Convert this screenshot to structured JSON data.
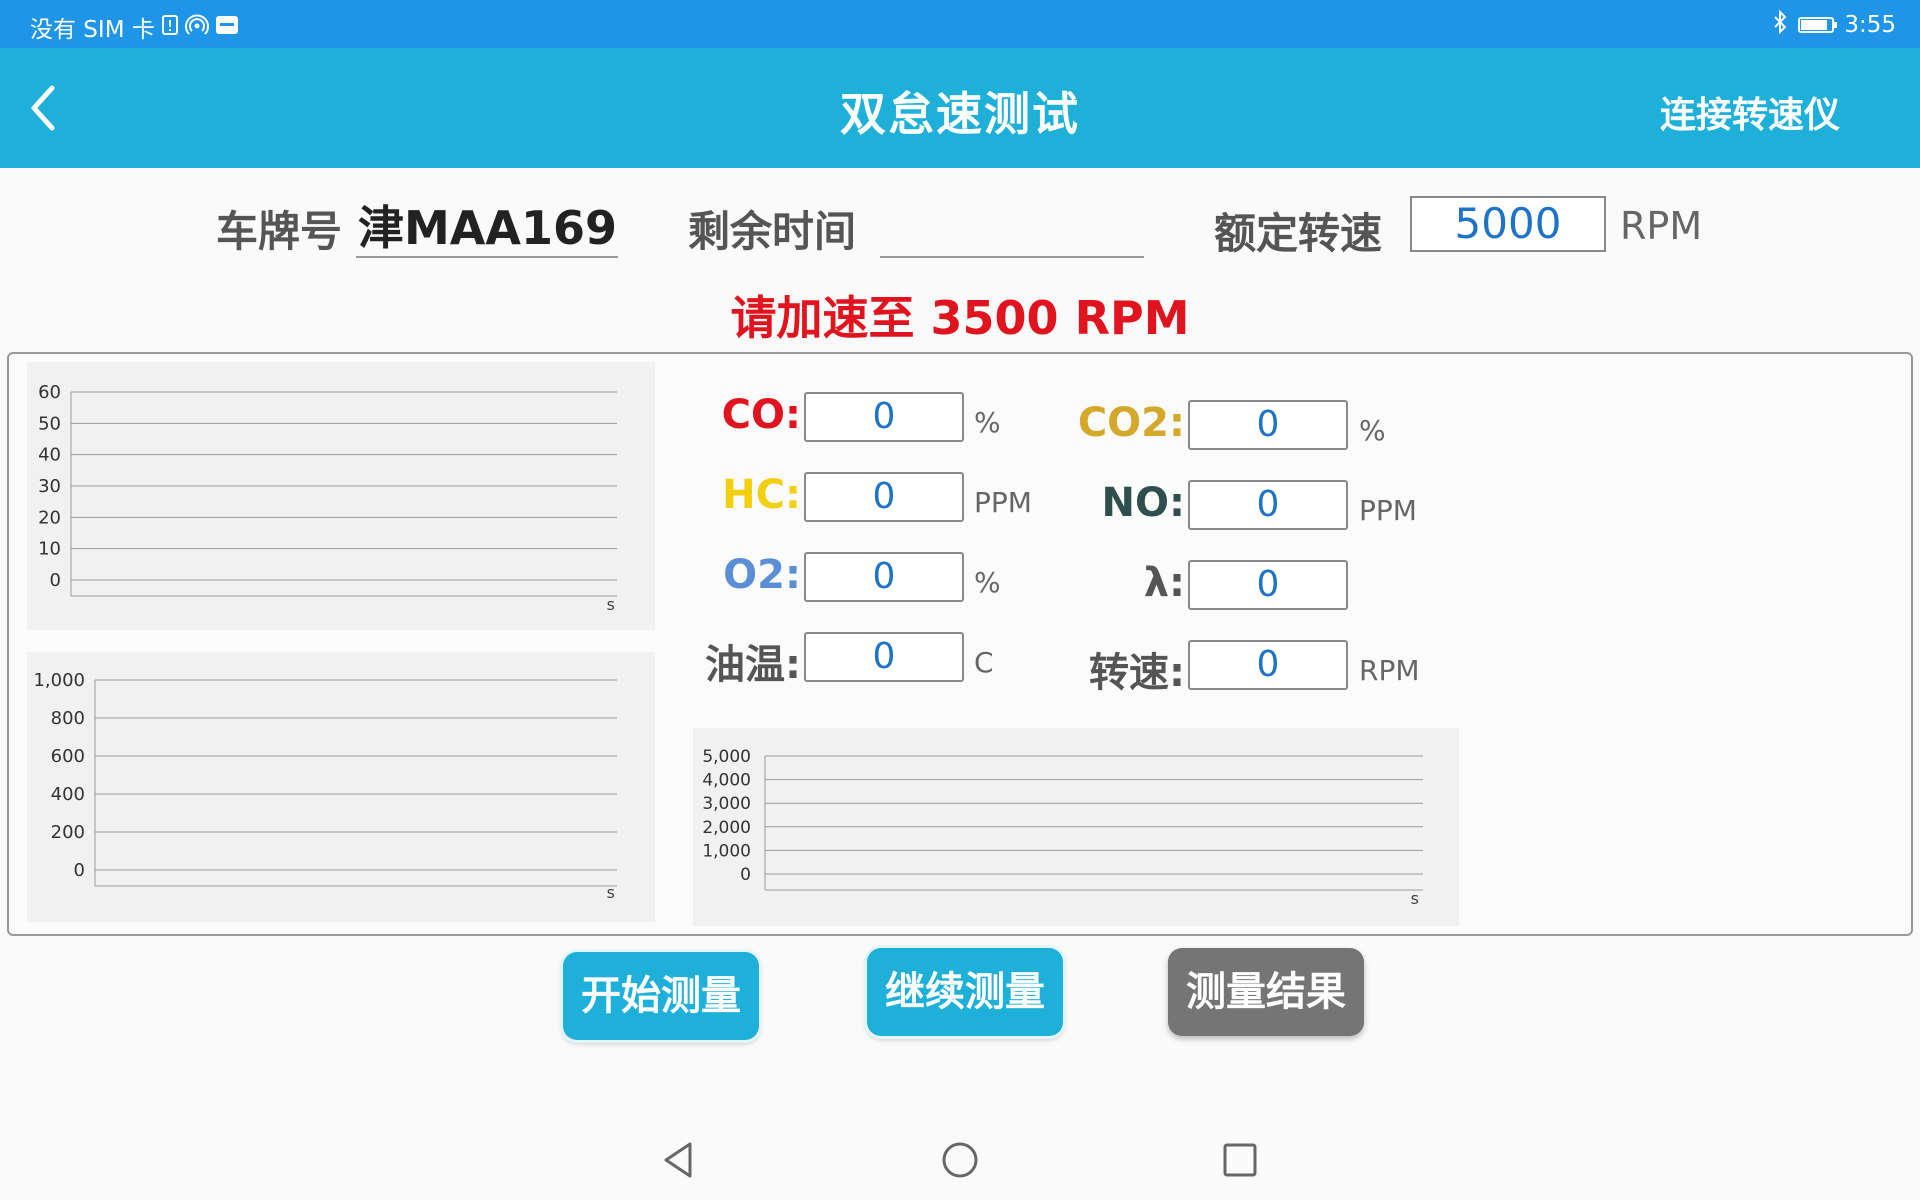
{
  "status": {
    "carrier": "没有 SIM 卡",
    "time": "3:55",
    "icons": [
      "sim-alert-icon",
      "hotspot-icon",
      "sms-icon",
      "bluetooth-icon",
      "battery-charging-icon"
    ]
  },
  "app_bar": {
    "title": "双怠速测试",
    "action": "连接转速仪",
    "back_icon": "chevron-left-icon"
  },
  "info": {
    "plate_label": "车牌号",
    "plate_value": "津MAA169",
    "remaining_label": "剩余时间",
    "remaining_value": "",
    "rated_label": "额定转速",
    "rated_value": "5000",
    "rated_unit": "RPM"
  },
  "prompt": "请加速至 3500 RPM",
  "measurements": {
    "co": {
      "label": "CO:",
      "value": "0",
      "unit": "%",
      "color": "#e0141e"
    },
    "hc": {
      "label": "HC:",
      "value": "0",
      "unit": "PPM",
      "color": "#f2cf10"
    },
    "o2": {
      "label": "O2:",
      "value": "0",
      "unit": "%",
      "color": "#5a8fd6"
    },
    "oil": {
      "label": "油温:",
      "value": "0",
      "unit": "C",
      "color": "#555555"
    },
    "co2": {
      "label": "CO2:",
      "value": "0",
      "unit": "%",
      "color": "#d4a82a"
    },
    "no": {
      "label": "NO:",
      "value": "0",
      "unit": "PPM",
      "color": "#2f4f4f"
    },
    "lambda": {
      "label": "λ:",
      "value": "0",
      "unit": "",
      "color": "#555555"
    },
    "rpm": {
      "label": "转速:",
      "value": "0",
      "unit": "RPM",
      "color": "#555555"
    }
  },
  "buttons": {
    "start": "开始测量",
    "continue": "继续测量",
    "result": "测量结果"
  },
  "chart_data": [
    {
      "type": "line",
      "yticks": [
        "60",
        "50",
        "40",
        "30",
        "20",
        "10",
        "0"
      ],
      "ylim": [
        0,
        60
      ],
      "xlabel": "s",
      "series": []
    },
    {
      "type": "line",
      "yticks": [
        "1,000",
        "800",
        "600",
        "400",
        "200",
        "0"
      ],
      "ylim": [
        0,
        1000
      ],
      "xlabel": "s",
      "series": []
    },
    {
      "type": "line",
      "yticks": [
        "5,000",
        "4,000",
        "3,000",
        "2,000",
        "1,000",
        "0"
      ],
      "ylim": [
        0,
        5000
      ],
      "xlabel": "s",
      "series": []
    }
  ]
}
